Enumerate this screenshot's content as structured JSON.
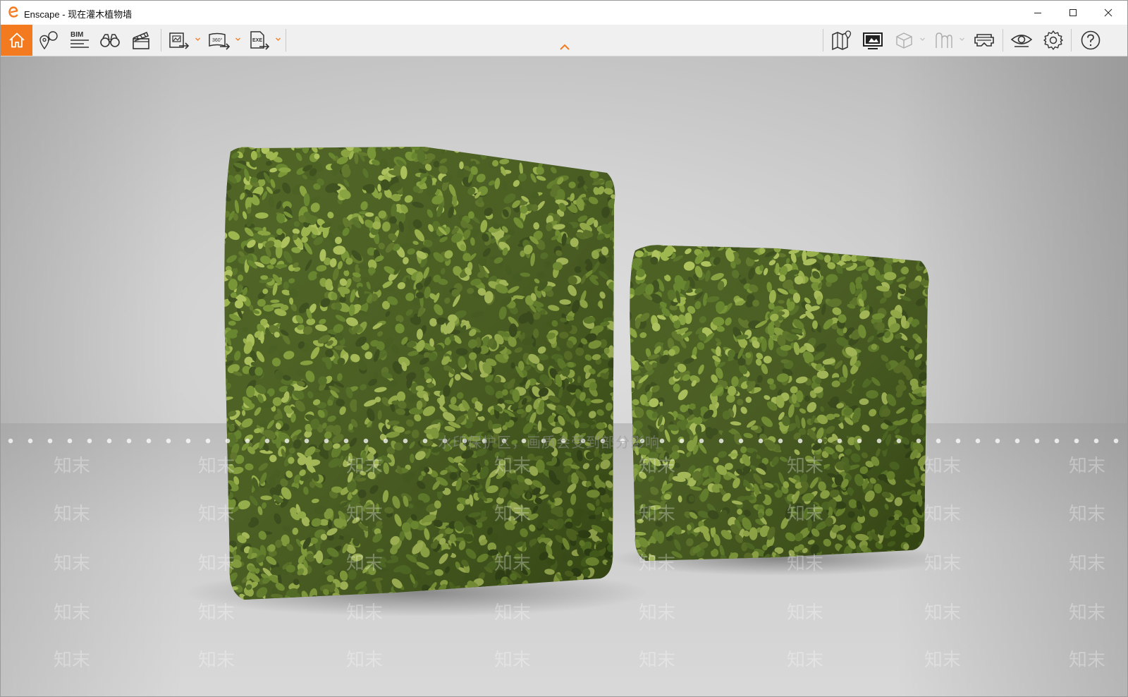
{
  "window": {
    "app_name": "Enscape",
    "separator": " - ",
    "document_name": "现在灌木植物墙"
  },
  "toolbar": {
    "left_icons": [
      "home-icon",
      "map-pin-icon",
      "bim-icon",
      "binoculars-icon",
      "clapperboard-icon"
    ],
    "bim_label": "BIM",
    "export_buttons": [
      {
        "icon": "screenshot-export-icon",
        "label": ""
      },
      {
        "icon": "panorama-export-icon",
        "label": "360°"
      },
      {
        "icon": "exe-export-icon",
        "label": "EXE"
      }
    ],
    "right_icons": [
      "map-icon",
      "monitor-icon",
      "cube-icon",
      "asset-library-icon",
      "vr-headset-icon",
      "eye-icon",
      "settings-icon",
      "help-icon"
    ],
    "accent_color": "#f47a20"
  },
  "viewport": {
    "watermark_center": "水印保护区，画质会受到部分影响",
    "watermark_mark": "知末",
    "hedge_color": "#4f6b1e"
  }
}
